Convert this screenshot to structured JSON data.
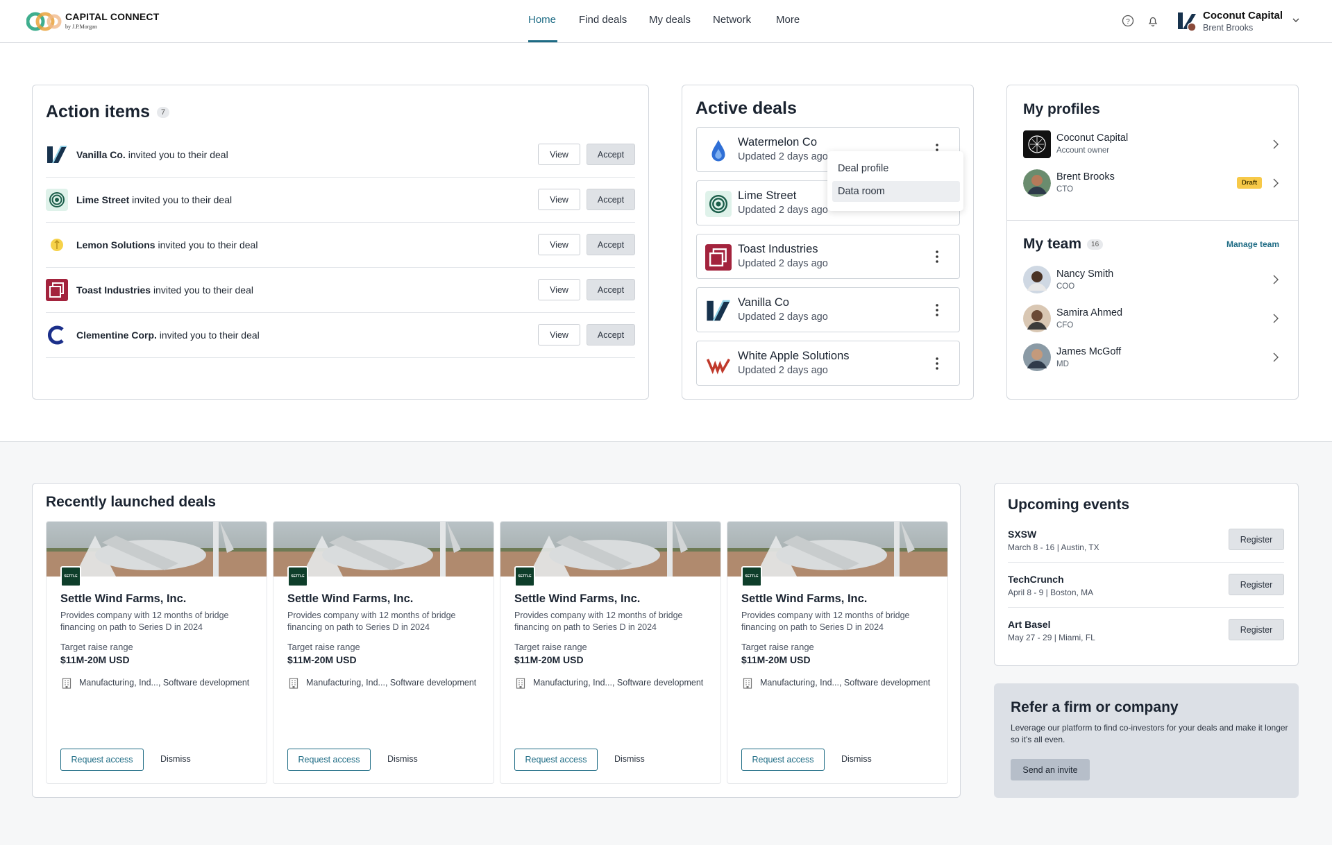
{
  "header": {
    "brand_title": "CAPITAL CONNECT",
    "brand_sub": "by J.P.Morgan",
    "nav": [
      "Home",
      "Find deals",
      "My deals",
      "Network",
      "More"
    ],
    "account_name": "Coconut Capital",
    "account_user": "Brent Brooks"
  },
  "action_items": {
    "title": "Action items",
    "count": "7",
    "view_label": "View",
    "accept_label": "Accept",
    "suffix": "invited you to their deal",
    "items": [
      {
        "company": "Vanilla Co."
      },
      {
        "company": "Lime Street"
      },
      {
        "company": "Lemon Solutions"
      },
      {
        "company": "Toast Industries"
      },
      {
        "company": "Clementine Corp."
      }
    ]
  },
  "active_deals": {
    "title": "Active deals",
    "deals": [
      {
        "name": "Watermelon Co",
        "updated": "Updated 2 days ago"
      },
      {
        "name": "Lime Street",
        "updated": "Updated 2 days ago"
      },
      {
        "name": "Toast Industries",
        "updated": "Updated 2 days ago"
      },
      {
        "name": "Vanilla Co",
        "updated": "Updated 2 days ago"
      },
      {
        "name": "White Apple Solutions",
        "updated": "Updated 2 days ago"
      }
    ],
    "menu": [
      "Deal profile",
      "Data room"
    ]
  },
  "profiles": {
    "title": "My profiles",
    "items": [
      {
        "name": "Coconut Capital",
        "role": "Account owner"
      },
      {
        "name": "Brent Brooks",
        "role": "CTO",
        "badge": "Draft"
      }
    ]
  },
  "team": {
    "title": "My team",
    "count": "16",
    "manage_label": "Manage team",
    "members": [
      {
        "name": "Nancy Smith",
        "role": "COO"
      },
      {
        "name": "Samira Ahmed",
        "role": "CFO"
      },
      {
        "name": "James McGoff",
        "role": "MD"
      }
    ]
  },
  "recent": {
    "title": "Recently launched deals",
    "badge_text": "SETTLE",
    "request_label": "Request access",
    "dismiss_label": "Dismiss",
    "raise_label": "Target raise range",
    "cards": [
      {
        "name": "Settle Wind Farms, Inc.",
        "desc": "Provides company with 12 months of bridge financing on path to Series D in 2024",
        "raise": "$11M-20M USD",
        "industry": "Manufacturing, Ind..., Software development"
      },
      {
        "name": "Settle Wind Farms, Inc.",
        "desc": "Provides company with 12 months of bridge financing on path to Series D in 2024",
        "raise": "$11M-20M USD",
        "industry": "Manufacturing, Ind..., Software development"
      },
      {
        "name": "Settle Wind Farms, Inc.",
        "desc": "Provides company with 12 months of bridge financing on path to Series D in 2024",
        "raise": "$11M-20M USD",
        "industry": "Manufacturing, Ind..., Software development"
      },
      {
        "name": "Settle Wind Farms, Inc.",
        "desc": "Provides company with 12 months of bridge financing on path to Series D in 2024",
        "raise": "$11M-20M USD",
        "industry": "Manufacturing, Ind..., Software development"
      }
    ]
  },
  "events": {
    "title": "Upcoming events",
    "register_label": "Register",
    "items": [
      {
        "name": "SXSW",
        "date": "March 8 - 16 | Austin, TX"
      },
      {
        "name": "TechCrunch",
        "date": "April 8 - 9 | Boston, MA"
      },
      {
        "name": "Art Basel",
        "date": "May 27 - 29 | Miami, FL"
      }
    ]
  },
  "refer": {
    "title": "Refer a firm or company",
    "text": "Leverage our platform to find co-investors for your deals and make it longer so it's all even.",
    "button": "Send an invite"
  },
  "colors": {
    "accent": "#1d6b84",
    "draft": "#f7c948",
    "settle": "#0e3e2a"
  }
}
